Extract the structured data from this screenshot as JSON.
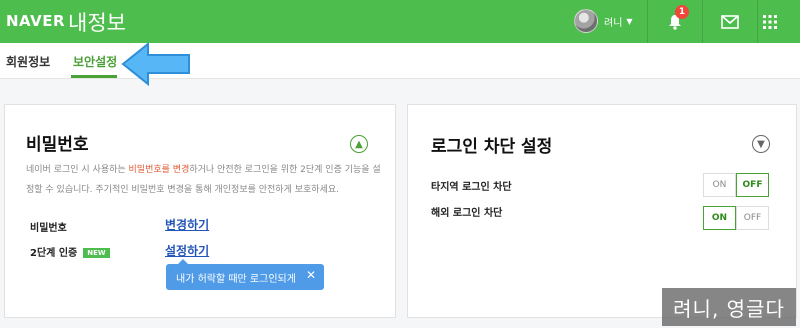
{
  "header": {
    "logo": "NAVER",
    "title": "내정보",
    "user_name": "려니",
    "notification_count": "1",
    "icons": [
      "bell-icon",
      "mail-icon",
      "apps-grid-icon"
    ],
    "bg_color": "#4dbd4e"
  },
  "tabs": [
    {
      "label": "회원정보",
      "active": false
    },
    {
      "label": "보안설정",
      "active": true
    }
  ],
  "password_card": {
    "title": "비밀번호",
    "desc_before": "네이버 로그인 시 사용하는 ",
    "desc_highlight": "비밀번호를 변경",
    "desc_after": "하거나 안전한 로그인을 위한 2단계 인증 기능을 설정할 수 있습니다. 주기적인 비밀번호 변경을 통해 개인정보를 안전하게 보호하세요.",
    "rows": [
      {
        "label": "비밀번호",
        "link": "변경하기"
      },
      {
        "label": "2단계 인증",
        "badge": "NEW",
        "link": "설정하기"
      }
    ],
    "tooltip": "내가 허락할 때만 로그인되게"
  },
  "login_block_card": {
    "title": "로그인 차단 설정",
    "rows": [
      {
        "label": "타지역 로그인 차단",
        "on_label": "ON",
        "off_label": "OFF",
        "state": "OFF"
      },
      {
        "label": "해외 로그인 차단",
        "on_label": "ON",
        "off_label": "OFF",
        "state": "ON"
      }
    ]
  },
  "watermark": "려니, 영글다",
  "colors": {
    "accent": "#4aa135",
    "link": "#2456b8",
    "tooltip": "#4f9be8",
    "highlight": "#e05a33"
  }
}
